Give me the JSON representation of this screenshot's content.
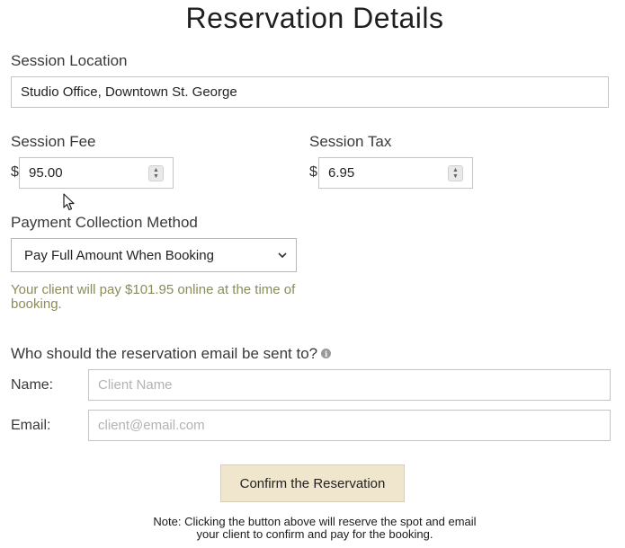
{
  "page_title": "Reservation Details",
  "session_location": {
    "label": "Session Location",
    "value": "Studio Office, Downtown St. George"
  },
  "session_fee": {
    "label": "Session Fee",
    "currency": "$",
    "value": "95.00"
  },
  "session_tax": {
    "label": "Session Tax",
    "currency": "$",
    "value": "6.95"
  },
  "payment_method": {
    "label": "Payment Collection Method",
    "selected": "Pay Full Amount When Booking",
    "help_text": "Your client will pay $101.95 online at the time of booking."
  },
  "email_section": {
    "question": "Who should the reservation email be sent to?",
    "name_label": "Name:",
    "name_placeholder": "Client Name",
    "email_label": "Email:",
    "email_placeholder": "client@email.com"
  },
  "confirm_button_label": "Confirm the Reservation",
  "note": "Note: Clicking the button above will reserve the spot and email your client to confirm and pay for the booking.",
  "colors": {
    "button_background": "#efe6cd",
    "help_text": "#8a8c5a"
  },
  "icons": {
    "info": "info-icon",
    "select_arrow": "chevron-down-icon",
    "spinner": "spinner-icon",
    "pointer": "mouse-cursor-icon"
  }
}
